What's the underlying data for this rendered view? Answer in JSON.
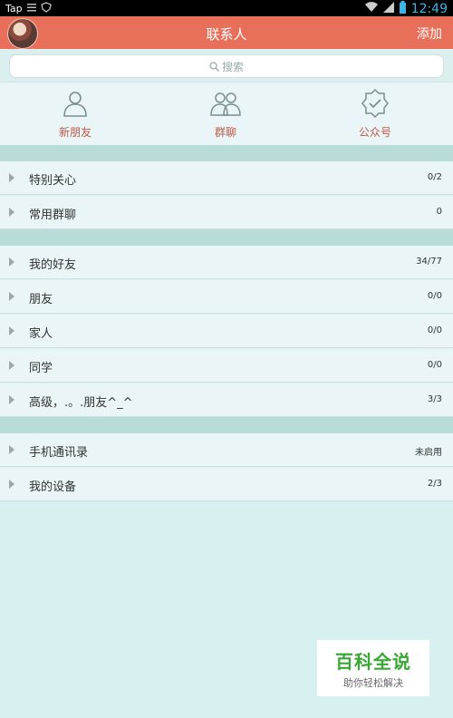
{
  "status_bar": {
    "carrier": "Tap",
    "time": "12:49"
  },
  "header": {
    "title": "联系人",
    "add_label": "添加"
  },
  "search": {
    "placeholder": "搜索"
  },
  "quick_entries": [
    {
      "label": "新朋友",
      "icon": "person-icon"
    },
    {
      "label": "群聊",
      "icon": "group-icon"
    },
    {
      "label": "公众号",
      "icon": "official-account-icon"
    }
  ],
  "groups": [
    [
      {
        "label": "特别关心",
        "count": "0/2"
      },
      {
        "label": "常用群聊",
        "count": "0"
      }
    ],
    [
      {
        "label": "我的好友",
        "count": "34/77"
      },
      {
        "label": "朋友",
        "count": "0/0"
      },
      {
        "label": "家人",
        "count": "0/0"
      },
      {
        "label": "同学",
        "count": "0/0"
      },
      {
        "label": "高级，.。.朋友^_^",
        "count": "3/3"
      }
    ],
    [
      {
        "label": "手机通讯录",
        "count": "未启用"
      },
      {
        "label": "我的设备",
        "count": "2/3"
      }
    ]
  ],
  "watermark": {
    "title": "百科全说",
    "subtitle": "助你轻松解决"
  },
  "colors": {
    "header": "#e8705b",
    "accent_label": "#c0584a",
    "background": "#d7f0f0",
    "separator": "#b8dcd8"
  }
}
